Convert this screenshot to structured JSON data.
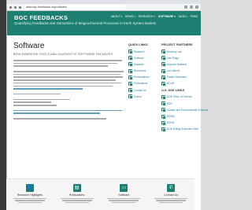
{
  "browser": {
    "url": "www.bgc-feedbacks.org/software/"
  },
  "header": {
    "title": "BGC FEEDBACKS",
    "subtitle": "Quantifying Feedbacks and Interactions of Biogeochemical Processes in Earth System Models",
    "nav": [
      {
        "label": "ABOUT",
        "active": false
      },
      {
        "label": "NEWS",
        "active": false
      },
      {
        "label": "RESEARCH",
        "active": false
      },
      {
        "label": "SOFTWARE",
        "active": true
      },
      {
        "label": "DATA",
        "active": false
      },
      {
        "label": "PUBS",
        "active": false
      }
    ]
  },
  "main": {
    "title": "Software",
    "subtitle": "BENCHMARKING TOOLS AND DIAGNOSTIC SOFTWARE PACKAGES"
  },
  "sidebar": {
    "quick_links": {
      "heading": "QUICK LINKS",
      "items": [
        "Research",
        "Software",
        "Datasets",
        "Resources",
        "Presentations",
        "Publications",
        "Contact Us",
        "Events"
      ]
    },
    "project_partners": {
      "heading": "PROJECT PARTNERS",
      "items": [
        "Berkeley Lab",
        "Oak Ridge",
        "Argonne National",
        "Los Alamos",
        "Pacific Northwest",
        "NCAR"
      ]
    },
    "doe_links": {
      "heading": "U.S. DOE LINKS",
      "items": [
        "DOE Office of Science",
        "BER",
        "Climate and Environmental Sciences",
        "RGMA",
        "ESMD",
        "DOE Energy Exascale Earth"
      ]
    }
  },
  "footer": {
    "columns": [
      {
        "icon": "person-icon",
        "glyph": "👤",
        "title": "Research Highlights"
      },
      {
        "icon": "document-icon",
        "glyph": "▤",
        "title": "Publications"
      },
      {
        "icon": "monitor-icon",
        "glyph": "▭",
        "title": "Software"
      },
      {
        "icon": "phone-icon",
        "glyph": "✆",
        "title": "Contact Us"
      }
    ]
  },
  "colors": {
    "brand": "#1c7f72",
    "link": "#2a7fa8"
  }
}
